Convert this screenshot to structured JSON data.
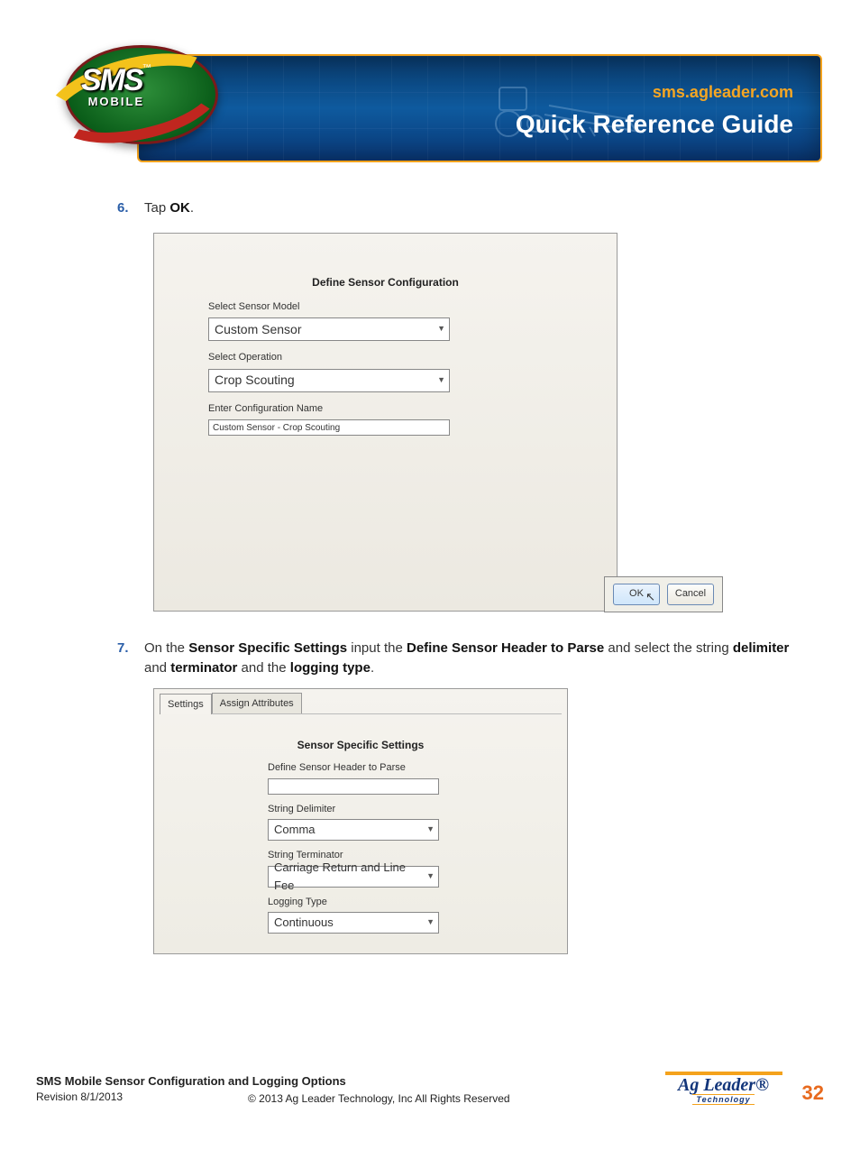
{
  "banner": {
    "url": "sms.agleader.com",
    "title": "Quick Reference Guide",
    "logo_main": "SMS",
    "logo_tm": "™",
    "logo_sub": "MOBILE"
  },
  "steps": {
    "s6": {
      "num": "6.",
      "pre": "Tap ",
      "bold": "OK",
      "post": "."
    },
    "s7": {
      "num": "7.",
      "t1": "On the ",
      "b1": "Sensor Specific Settings",
      "t2": " input the ",
      "b2": "Define Sensor Header to Parse",
      "t3": " and select the string ",
      "b3": "delimiter",
      "t4": " and ",
      "b4": "terminator",
      "t5": " and the ",
      "b5": "logging type",
      "t6": "."
    }
  },
  "dialog1": {
    "title": "Define Sensor Configuration",
    "label_model": "Select Sensor Model",
    "value_model": "Custom Sensor",
    "label_op": "Select Operation",
    "value_op": "Crop Scouting",
    "label_name": "Enter Configuration Name",
    "value_name": "Custom Sensor - Crop Scouting",
    "ok": "OK",
    "cancel": "Cancel"
  },
  "dialog2": {
    "tab1": "Settings",
    "tab2": "Assign Attributes",
    "title": "Sensor Specific Settings",
    "label_header": "Define Sensor Header to Parse",
    "value_header": "",
    "label_delim": "String Delimiter",
    "value_delim": "Comma",
    "label_term": "String Terminator",
    "value_term": "Carriage Return and Line Fee",
    "label_log": "Logging Type",
    "value_log": "Continuous"
  },
  "footer": {
    "title": "SMS Mobile Sensor Configuration and Logging Options",
    "revision": "Revision 8/1/2013",
    "copyright": "© 2013 Ag Leader Technology, Inc All Rights Reserved",
    "logo_main": "Ag Leader",
    "logo_reg": "®",
    "logo_sub": "Technology",
    "page": "32"
  }
}
